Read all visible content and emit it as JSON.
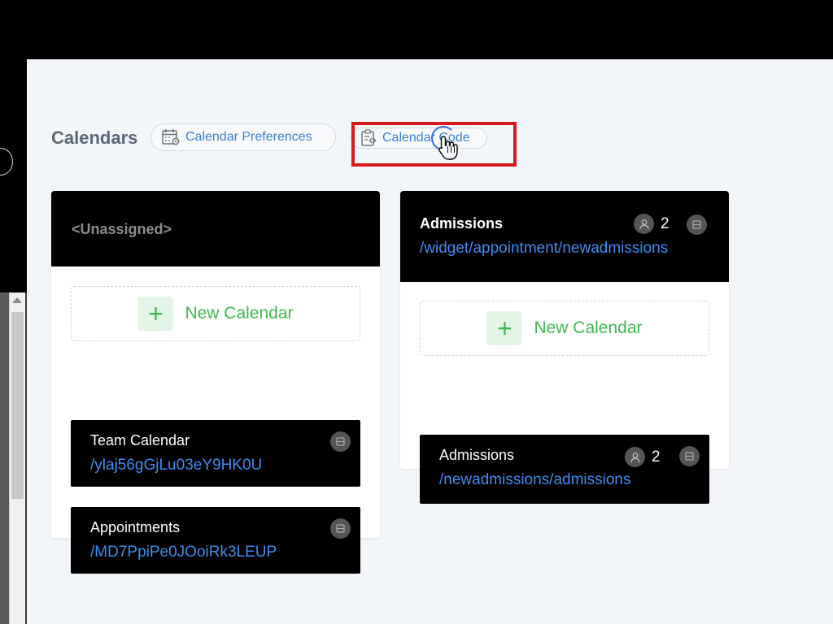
{
  "page": {
    "title": "Calendars"
  },
  "toolbar": {
    "preferences_label": "Calendar Preferences",
    "code_label": "Calendar Code"
  },
  "columns": [
    {
      "header": "<Unassigned>",
      "new_calendar_label": "New Calendar",
      "calendars": [
        {
          "name": "Team Calendar",
          "url": "/ylaj56gGjLu03eY9HK0U"
        },
        {
          "name": "Appointments",
          "url": "/MD7PpiPe0JOoiRk3LEUP"
        }
      ]
    },
    {
      "header": "Admissions",
      "header_url": "/widget/appointment/newadmissions",
      "user_count": "2",
      "new_calendar_label": "New Calendar",
      "calendars": [
        {
          "name": "Admissions",
          "url": "/newadmissions/admissions",
          "user_count": "2"
        }
      ]
    }
  ],
  "colors": {
    "accent": "#3b7fd9",
    "link": "#3b8ef0",
    "green": "#3fb950",
    "highlight": "#d71920"
  },
  "icons": [
    "calendar-settings-icon",
    "clipboard-code-icon",
    "user-icon",
    "menu-icon",
    "plus-icon",
    "hand-cursor-icon"
  ]
}
